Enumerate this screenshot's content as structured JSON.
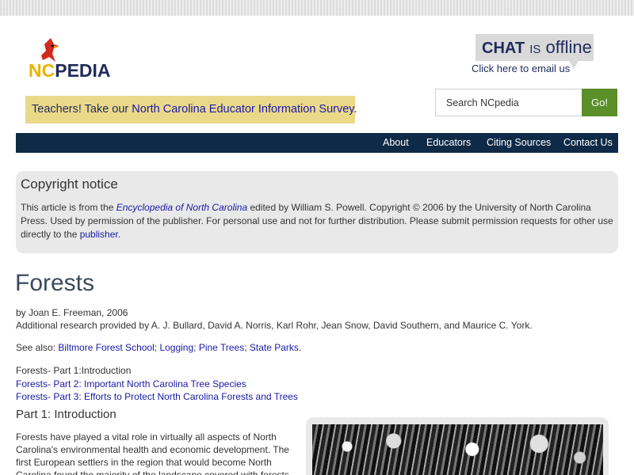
{
  "logo": {
    "nc": "NC",
    "pedia": "PEDIA"
  },
  "chat": {
    "chat": "CHAT",
    "is": "IS",
    "status": "offline",
    "email_link": "Click here to email us"
  },
  "survey": {
    "prefix": "Teachers! Take our ",
    "link": "North Carolina Educator Information Survey."
  },
  "search": {
    "placeholder": "Search NCpedia",
    "button": "Go!"
  },
  "nav": {
    "items": [
      "About",
      "Educators",
      "Citing Sources",
      "Contact Us"
    ]
  },
  "copyright": {
    "heading": "Copyright notice",
    "text1": "This article is from the ",
    "book": "Encyclopedia of North Carolina",
    "text2": " edited by William S. Powell. Copyright © 2006 by the University of North Carolina Press. Used by permission of the publisher. For personal use and not for further distribution. Please submit permission requests for other use directly to the ",
    "publisher_link": "publisher",
    "text3": "."
  },
  "article": {
    "title": "Forests",
    "byline": "by Joan E. Freeman, 2006",
    "research": "Additional research provided by A. J. Bullard, David A. Norris, Karl Rohr, Jean Snow, David Southern, and Maurice C. York.",
    "see_also_label": "See also: ",
    "see_also": [
      "Biltmore Forest School",
      "Logging",
      "Pine Trees",
      "State Parks"
    ],
    "parts": [
      {
        "label": "Forests- Part 1:Introduction",
        "link": false
      },
      {
        "label": "Forests- Part 2: Important North Carolina Tree Species",
        "link": true
      },
      {
        "label": "Forests- Part 3: Efforts to Protect North Carolina Forests and Trees",
        "link": true
      }
    ],
    "section_heading": "Part 1: Introduction",
    "intro": "Forests have played a vital role in virtually all aspects of North Carolina's environmental health and economic development. The first European settlers in the region that would become North Carolina found the majority of the landscape covered with forests. Huge"
  }
}
